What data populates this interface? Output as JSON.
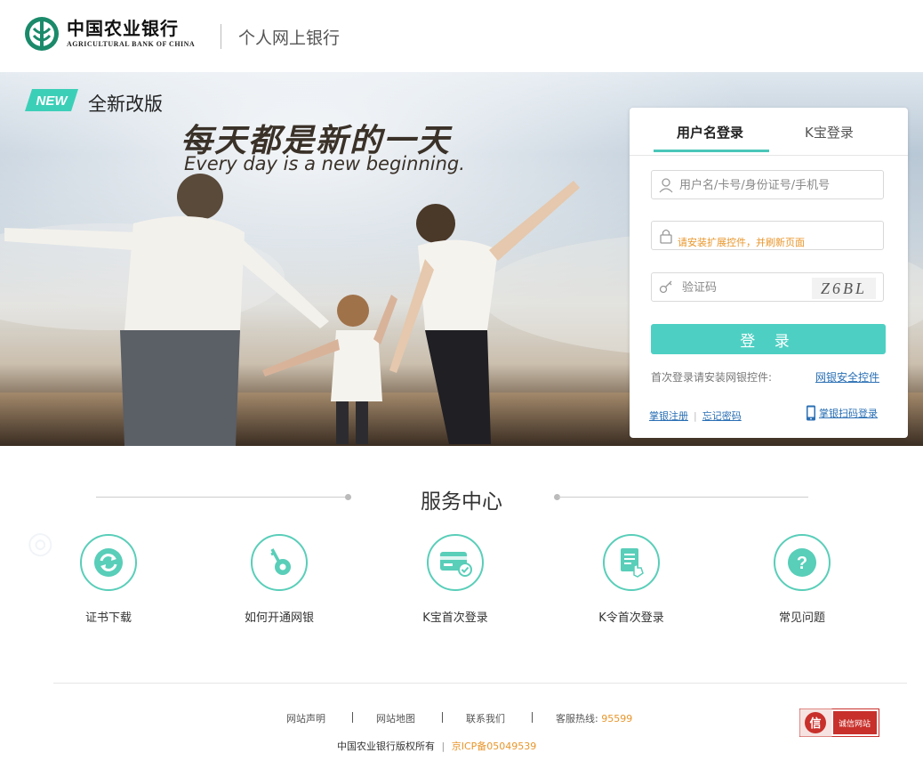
{
  "header": {
    "bank_name_cn": "中国农业银行",
    "bank_name_en": "AGRICULTURAL BANK OF CHINA",
    "subtitle": "个人网上银行"
  },
  "banner": {
    "badge": "NEW",
    "badge_label": "全新改版",
    "slogan_cn": "每天都是新的一天",
    "slogan_en": "Every day is a new beginning."
  },
  "login": {
    "tabs": [
      {
        "label": "用户名登录",
        "active": true
      },
      {
        "label": "K宝登录",
        "active": false
      }
    ],
    "username_placeholder": "用户名/卡号/身份证号/手机号",
    "password_warning": "请安装扩展控件，并刷新页面",
    "captcha_placeholder": "验证码",
    "captcha_text": "Z6BL",
    "submit_label": "登 录",
    "first_login_hint": "首次登录请安装网银控件:",
    "first_login_link": "网银安全控件",
    "register_link": "掌银注册",
    "forgot_link": "忘记密码",
    "scan_link": "掌银扫码登录"
  },
  "service_center": {
    "title": "服务中心",
    "items": [
      {
        "label": "证书下载",
        "icon": "refresh-icon"
      },
      {
        "label": "如何开通网银",
        "icon": "key-icon"
      },
      {
        "label": "K宝首次登录",
        "icon": "card-check-icon"
      },
      {
        "label": "K令首次登录",
        "icon": "document-touch-icon"
      },
      {
        "label": "常见问题",
        "icon": "question-icon"
      }
    ]
  },
  "footer": {
    "links": [
      "网站声明",
      "网站地图",
      "联系我们"
    ],
    "hotline_label": "客服热线:",
    "hotline_number": "95599",
    "copyright": "中国农业银行版权所有",
    "icp": "京ICP备05049539",
    "trust_badge": "诚信网站",
    "trust_glyph": "信"
  },
  "colors": {
    "accent": "#4dd0c3",
    "link": "#2a6fb4",
    "warning": "#e8962b",
    "brand_green": "#1a8a6a"
  }
}
